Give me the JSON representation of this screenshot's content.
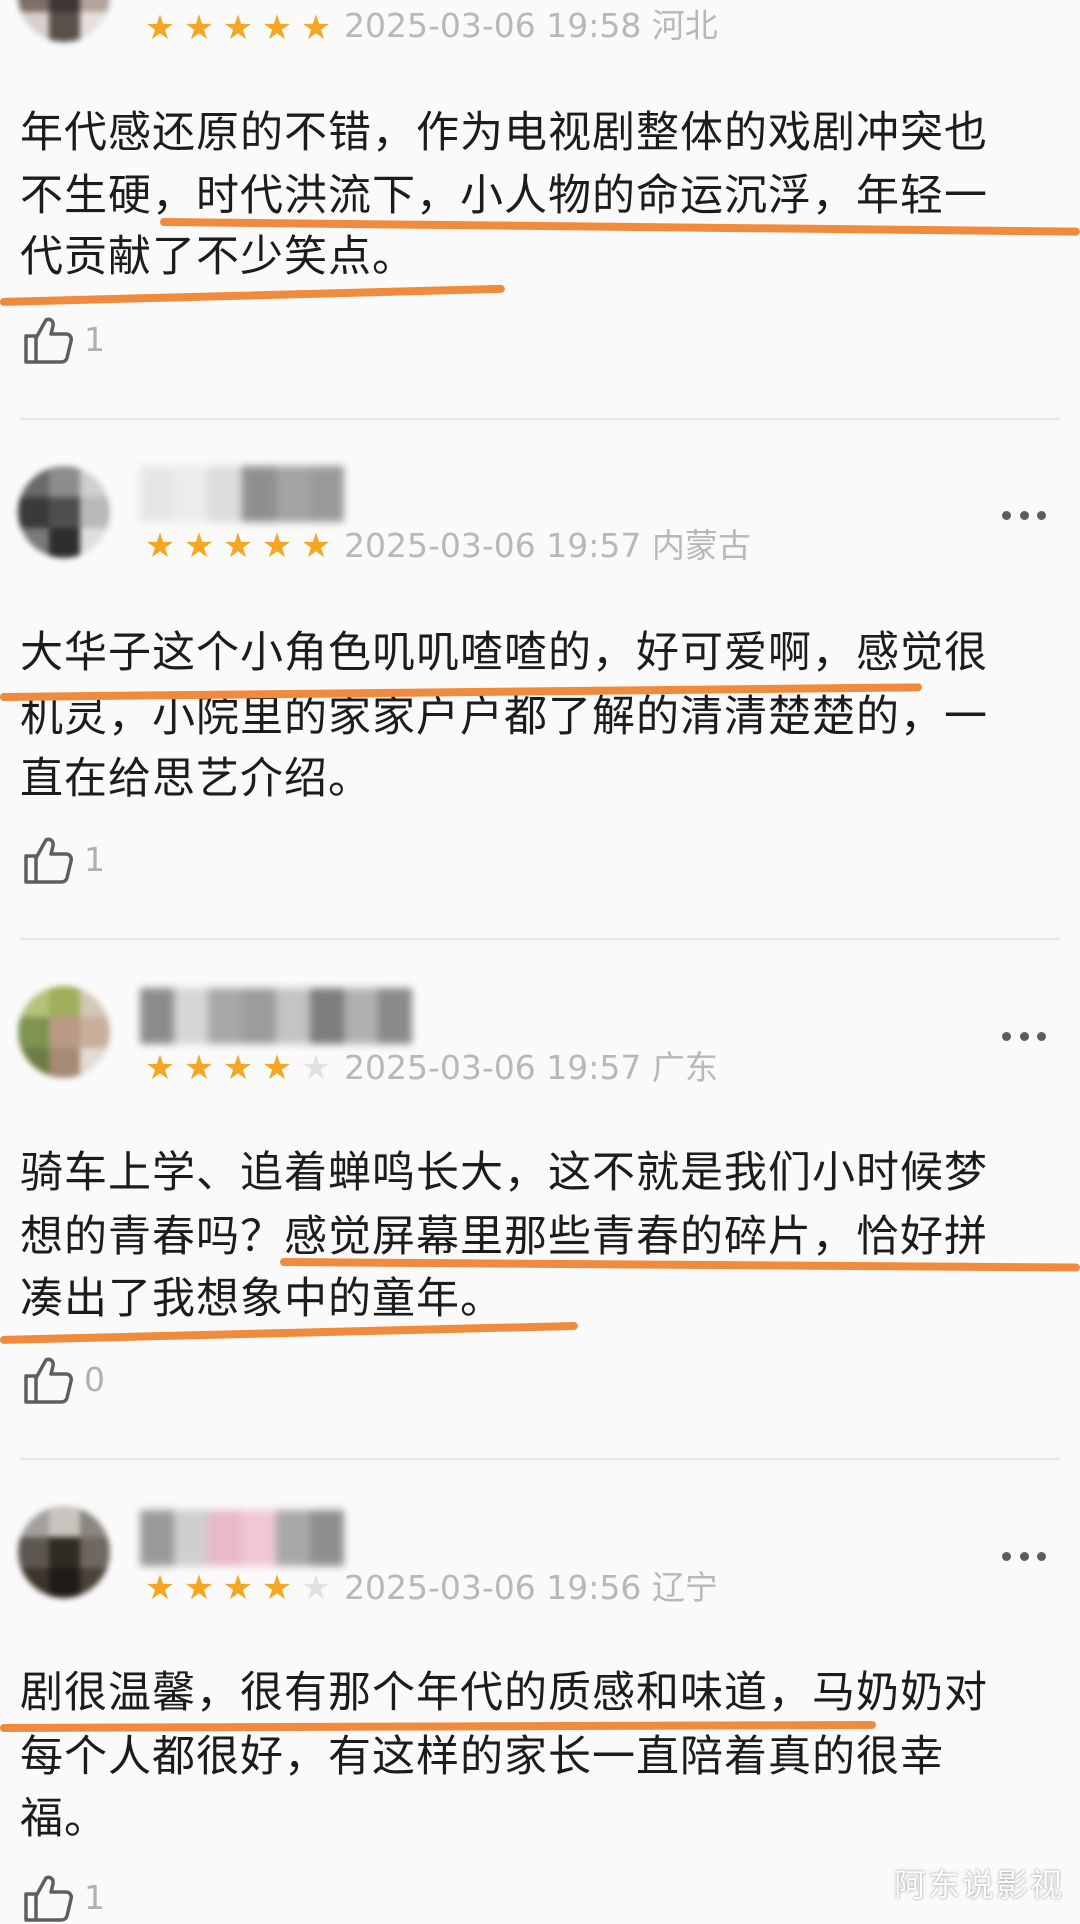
{
  "reviews": [
    {
      "date": "2025-03-06 19:58",
      "location": "河北",
      "rating": 5,
      "lines": [
        "年代感还原的不错，作为电视剧整体的戏剧冲突也",
        "不生硬，时代洪流下，小人物的命运沉浮，年轻一",
        "代贡献了不少笑点。"
      ],
      "likes": "1"
    },
    {
      "date": "2025-03-06 19:57",
      "location": "内蒙古",
      "rating": 5,
      "lines": [
        "大华子这个小角色叽叽喳喳的，好可爱啊，感觉很",
        "机灵，小院里的家家户户都了解的清清楚楚的，一",
        "直在给思艺介绍。"
      ],
      "likes": "1"
    },
    {
      "date": "2025-03-06 19:57",
      "location": "广东",
      "rating": 4,
      "lines": [
        "骑车上学、追着蝉鸣长大，这不就是我们小时候梦",
        "想的青春吗？感觉屏幕里那些青春的碎片，恰好拼",
        "凑出了我想象中的童年。"
      ],
      "likes": "0"
    },
    {
      "date": "2025-03-06 19:56",
      "location": "辽宁",
      "rating": 4,
      "lines": [
        "剧很温馨，很有那个年代的质感和味道，马奶奶对",
        "每个人都很好，有这样的家长一直陪着真的很幸",
        "福。"
      ],
      "likes": "1"
    }
  ],
  "colors": {
    "star_filled": "#f5a623",
    "star_empty": "#e2e2e2",
    "highlight": "#f08a3c"
  },
  "icons": {
    "like": "thumbs-up-icon",
    "more": "more-dots-icon"
  },
  "watermark": "阿东说影视"
}
